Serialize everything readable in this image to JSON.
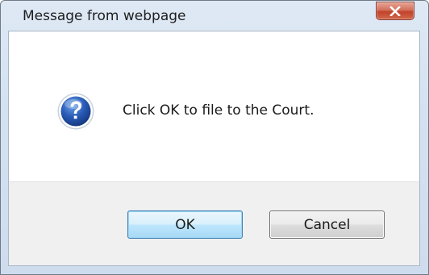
{
  "window": {
    "title": "Message from webpage",
    "close_icon": "close-icon",
    "close_color": "#c1432a"
  },
  "message": {
    "icon": "question-icon",
    "icon_color": "#1f4fa0",
    "text": "Click OK to file to the Court."
  },
  "buttons": {
    "ok_label": "OK",
    "cancel_label": "Cancel"
  }
}
